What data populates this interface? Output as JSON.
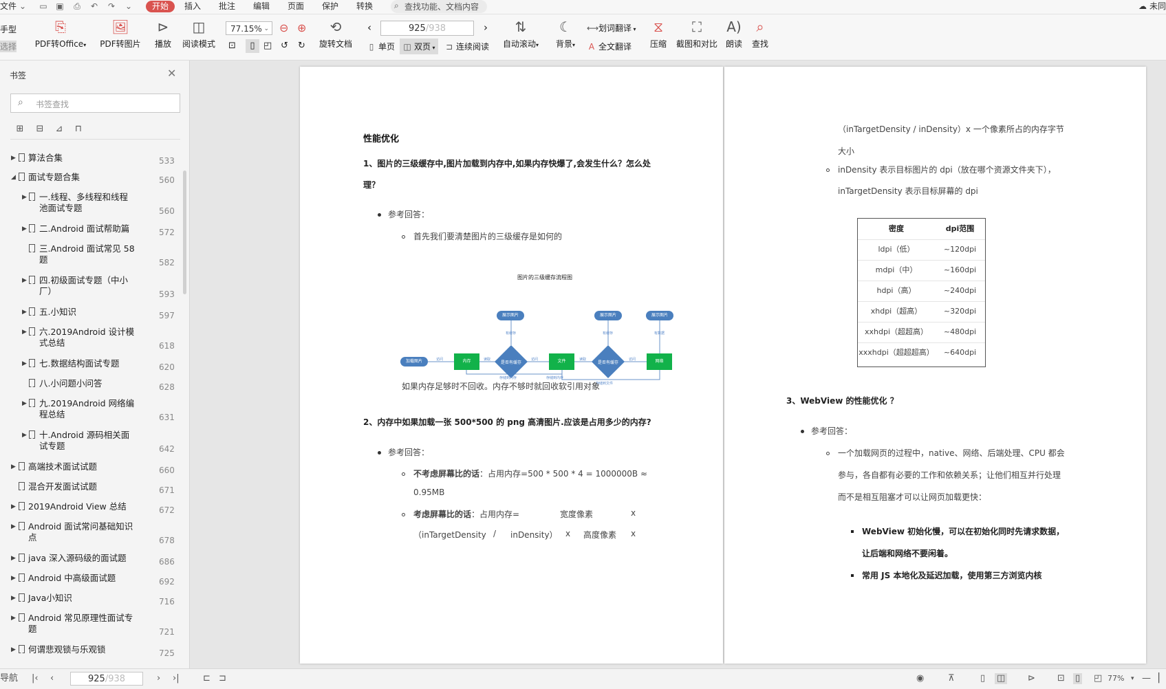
{
  "menubar": {
    "file": "文件",
    "tabs": [
      "开始",
      "插入",
      "批注",
      "编辑",
      "页面",
      "保护",
      "转换"
    ],
    "search_placeholder": "查找功能、文档内容",
    "sync_label": "未同"
  },
  "toolbar": {
    "hand": "手型",
    "select": "选择",
    "pdf_to_office": "PDF转Office",
    "pdf_to_image": "PDF转图片",
    "play": "播放",
    "read_mode": "阅读模式",
    "zoom": "77.15%",
    "rotate": "旋转文档",
    "current_page": "925",
    "total_pages": "/938",
    "single": "单页",
    "double": "双页",
    "continuous": "连续阅读",
    "auto_scroll": "自动滚动",
    "background": "背景",
    "word_translate": "划词翻译",
    "full_translate": "全文翻译",
    "compress": "压缩",
    "screenshot_compare": "截图和对比",
    "read_aloud": "朗读",
    "find": "查找"
  },
  "sidebar": {
    "title": "书签",
    "search_placeholder": "书签查找",
    "bookmarks": [
      {
        "label": "算法合集",
        "page": "533"
      },
      {
        "label": "面试专题合集",
        "page": "560"
      },
      {
        "label": "一.线程、多线程和线程池面试专题",
        "page": "560"
      },
      {
        "label": "二.Android 面试帮助篇",
        "page": "572"
      },
      {
        "label": "三.Android 面试常见 58 题",
        "page": "582"
      },
      {
        "label": "四.初级面试专题（中小厂）",
        "page": "593"
      },
      {
        "label": "五.小知识",
        "page": "597"
      },
      {
        "label": "六.2019Android 设计模式总结",
        "page": "618"
      },
      {
        "label": "七.数据结构面试专题",
        "page": "620"
      },
      {
        "label": "八.小问题小问答",
        "page": "628"
      },
      {
        "label": "九.2019Android 网络编程总结",
        "page": "631"
      },
      {
        "label": "十.Android 源码相关面试专题",
        "page": "642"
      },
      {
        "label": "高端技术面试试题",
        "page": "660"
      },
      {
        "label": "混合开发面试试题",
        "page": "671"
      },
      {
        "label": "2019Android View 总结",
        "page": "672"
      },
      {
        "label": "Android 面试常问基础知识点",
        "page": "678"
      },
      {
        "label": "java 深入源码级的面试题",
        "page": "686"
      },
      {
        "label": "Android 中高级面试题",
        "page": "692"
      },
      {
        "label": "Java小知识",
        "page": "716"
      },
      {
        "label": "Android 常见原理性面试专题",
        "page": "721"
      },
      {
        "label": "何谓悲观锁与乐观锁",
        "page": "725"
      }
    ]
  },
  "left_page": {
    "heading": "性能优化",
    "q1_line1": "1、图片的三级缓存中,图片加载到内存中,如果内存快爆了,会发生什么？怎么处",
    "q1_line2": "理？",
    "ref_answer": "参考回答：",
    "q1_sub": "首先我们要清楚图片的三级缓存是如何的",
    "flow_title": "图片的三级缓存流程图",
    "flow": {
      "load": "加载图片",
      "memory": "内存",
      "has_cache1": "是否有缓存",
      "file": "文件",
      "has_cache2": "是否有缓存",
      "network": "网络",
      "show1": "展示图片",
      "show2": "展示图片",
      "show3": "展示图片",
      "l_find1": "访问",
      "l_read": "读取",
      "l_find2": "访问",
      "l_read2": "读取",
      "l_find3": "访问",
      "l_has1": "有缓存",
      "l_has2": "有缓存",
      "l_has3": "有数据",
      "l_store_mem": "存储到内存",
      "l_store_mem2": "存储到内存",
      "l_store_file": "存储到文件"
    },
    "q1_answer": "如果内存足够时不回收。内存不够时就回收软引用对象",
    "q2": "2、内存中如果加载一张 500*500 的 png 高清图片.应该是占用多少的内存?",
    "ref_answer2": "参考回答：",
    "b1_bold": "不考虑屏幕比的话",
    "b1_text": "：占用内存=500 * 500 * 4 = 1000000B ≈",
    "b1_text2": "0.95MB",
    "b2_bold": "考虑屏幕比的话",
    "b2_text": "：占用内存=",
    "b2_width": "宽度像素",
    "b2_x1": "x",
    "b2_l2a": "（inTargetDensity",
    "b2_l2b": "/",
    "b2_l2c": "inDensity）",
    "b2_l2d": "x",
    "b2_l2e": "高度像素",
    "b2_l2f": "x"
  },
  "right_page": {
    "r1": "（inTargetDensity / inDensity）x  一个像素所占的内存字节",
    "r2": "大小",
    "r3": "inDensity 表示目标图片的 dpi（放在哪个资源文件夹下），",
    "r4": "inTargetDensity 表示目标屏幕的 dpi",
    "table_head": [
      "密度",
      "dpi范围"
    ],
    "table_rows": [
      [
        "ldpi（低）",
        "~120dpi"
      ],
      [
        "mdpi（中）",
        "~160dpi"
      ],
      [
        "hdpi（高）",
        "~240dpi"
      ],
      [
        "xhdpi（超高）",
        "~320dpi"
      ],
      [
        "xxhdpi（超超高）",
        "~480dpi"
      ],
      [
        "xxxhdpi（超超超高）",
        "~640dpi"
      ]
    ],
    "q3": "3、WebView 的性能优化 ？",
    "ref_answer": "参考回答：",
    "p1": "一个加载网页的过程中，native、网络、后端处理、CPU 都会",
    "p2": "参与，各自都有必要的工作和依赖关系；让他们相互并行处理",
    "p3": "而不是相互阻塞才可以让网页加载更快：",
    "s1a": "WebView 初始化慢，可以在初始化同时先请求数据，",
    "s1b": "让后端和网络不要闲着。",
    "s2": "常用  JS  本地化及延迟加载，使用第三方浏览内核"
  },
  "statusbar": {
    "nav": "导航",
    "page": "925",
    "total": "/938",
    "zoom": "77%"
  }
}
